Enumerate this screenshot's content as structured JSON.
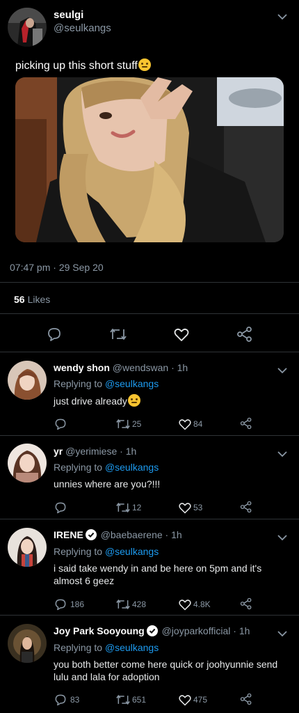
{
  "main_tweet": {
    "display_name": "seulgi",
    "handle": "@seulkangs",
    "text": "picking up this short stuff",
    "timestamp": "07:47 pm · 29 Sep 20",
    "likes_count": "56",
    "likes_label": "Likes"
  },
  "replies": [
    {
      "display_name": "wendy shon",
      "handle": "@wendswan",
      "time": "· 1h",
      "verified": false,
      "replying_prefix": "Replying to",
      "replying_to": "@seulkangs",
      "text": "just drive already",
      "retweets": "25",
      "likes": "84",
      "replies": ""
    },
    {
      "display_name": "yr",
      "handle": "@yerimiese",
      "time": "· 1h",
      "verified": false,
      "replying_prefix": "Replying to",
      "replying_to": "@seulkangs",
      "text": "unnies where are you?!!!",
      "retweets": "12",
      "likes": "53",
      "replies": ""
    },
    {
      "display_name": "IRENE",
      "handle": "@baebaerene",
      "time": "· 1h",
      "verified": true,
      "replying_prefix": "Replying to",
      "replying_to": "@seulkangs",
      "text": "i said take wendy in and be here on 5pm and it's almost 6 geez",
      "retweets": "428",
      "likes": "4.8K",
      "replies": "186"
    },
    {
      "display_name": "Joy Park Sooyoung",
      "handle": "@joyparkofficial",
      "time": "· 1h",
      "verified": true,
      "replying_prefix": "Replying to",
      "replying_to": "@seulkangs",
      "text": "you both better come here quick or joohyunnie send lulu and lala for adoption",
      "retweets": "651",
      "likes": "475",
      "replies": "83"
    }
  ],
  "colors": {
    "background": "#000000",
    "muted": "#8b98a5",
    "link": "#1d9bf0",
    "divider": "#2f3336"
  },
  "icons": [
    "chevron-down-icon",
    "reply-icon",
    "retweet-icon",
    "like-icon",
    "share-icon",
    "verified-badge-icon"
  ]
}
